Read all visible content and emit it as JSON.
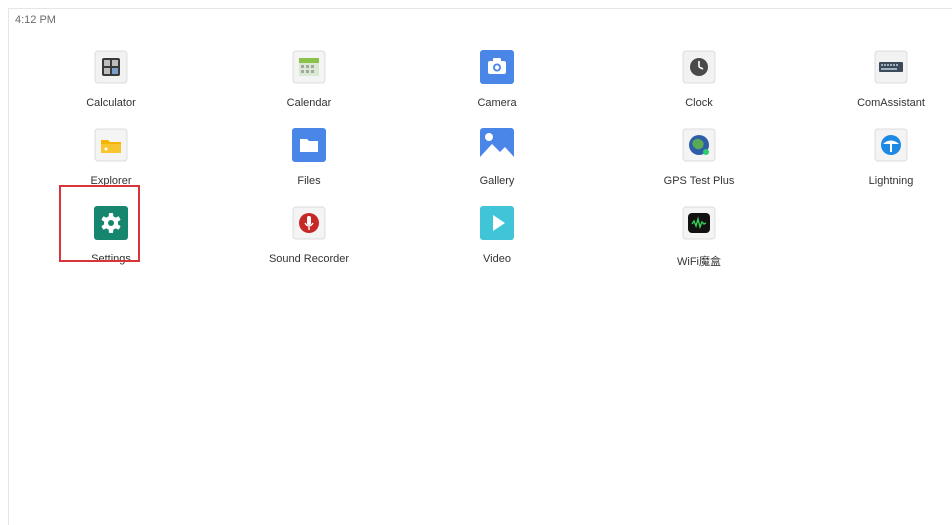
{
  "status_bar": {
    "time": "4:12 PM"
  },
  "apps": [
    {
      "label": "Calculator",
      "icon": "calculator-icon"
    },
    {
      "label": "Calendar",
      "icon": "calendar-icon"
    },
    {
      "label": "Camera",
      "icon": "camera-icon"
    },
    {
      "label": "Clock",
      "icon": "clock-icon"
    },
    {
      "label": "ComAssistant",
      "icon": "comassistant-icon"
    },
    {
      "label": "Explorer",
      "icon": "explorer-folder-icon"
    },
    {
      "label": "Files",
      "icon": "files-folder-icon"
    },
    {
      "label": "Gallery",
      "icon": "gallery-image-icon"
    },
    {
      "label": "GPS Test Plus",
      "icon": "gps-globe-icon"
    },
    {
      "label": "Lightning",
      "icon": "lightning-icon"
    },
    {
      "label": "Settings",
      "icon": "gear-icon"
    },
    {
      "label": "Sound Recorder",
      "icon": "microphone-icon"
    },
    {
      "label": "Video",
      "icon": "play-icon"
    },
    {
      "label": "WiFi魔盒",
      "icon": "wifi-box-icon"
    }
  ],
  "highlight": {
    "target": "Settings",
    "color": "#d9343a"
  }
}
